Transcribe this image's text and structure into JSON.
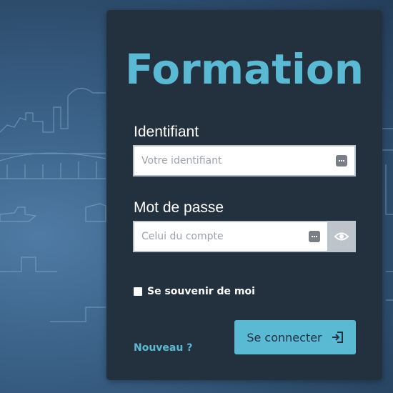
{
  "app": {
    "title": "Formation"
  },
  "login": {
    "username_label": "Identifiant",
    "username_placeholder": "Votre identifiant",
    "password_label": "Mot de passe",
    "password_placeholder": "Celui du compte",
    "remember_label": "Se souvenir de moi",
    "remember_checked": false,
    "new_link": "Nouveau ?",
    "submit_label": "Se connecter"
  },
  "icons": {
    "username_field": "keyboard-icon",
    "password_field": "keyboard-icon",
    "password_toggle": "eye-icon",
    "submit": "sign-in-icon"
  },
  "colors": {
    "accent": "#5bbad3",
    "card": "#23313f",
    "text": "#ffffff",
    "input_bg": "#ffffff",
    "eye_button_bg": "#bdc4ca"
  }
}
